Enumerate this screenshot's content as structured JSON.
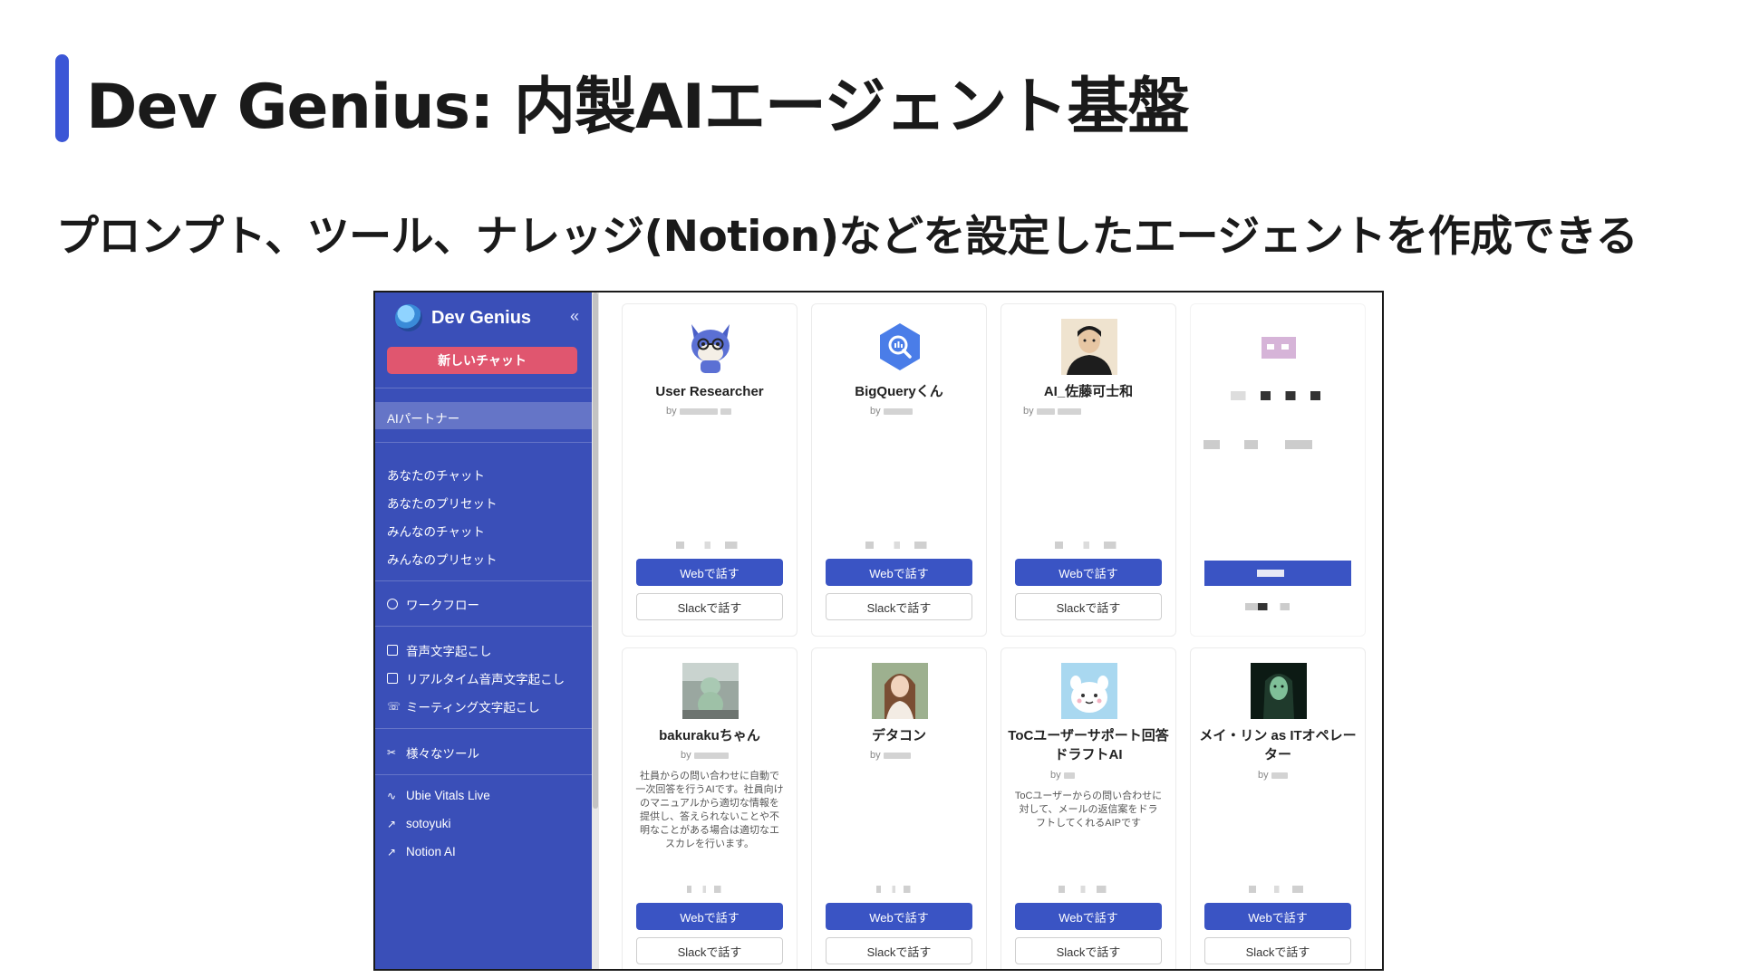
{
  "slide": {
    "title": "Dev Genius: 内製AIエージェント基盤",
    "subtitle": "プロンプト、ツール、ナレッジ(Notion)などを設定したエージェントを作成できる"
  },
  "sidebar": {
    "app_title": "Dev Genius",
    "collapse_icon": "«",
    "new_chat_label": "新しいチャット",
    "active_item": "AIパートナー",
    "items": [
      {
        "label": "あなたのチャット"
      },
      {
        "label": "あなたのプリセット"
      },
      {
        "label": "みんなのチャット"
      },
      {
        "label": "みんなのプリセット"
      },
      {
        "label": "ワークフロー",
        "icon": "workflow-icon"
      },
      {
        "label": "音声文字起こし",
        "icon": "document-icon"
      },
      {
        "label": "リアルタイム音声文字起こし",
        "icon": "screen-icon"
      },
      {
        "label": "ミーティング文字起こし",
        "icon": "phone-icon"
      },
      {
        "label": "様々なツール",
        "icon": "tools-icon"
      },
      {
        "label": "Ubie Vitals Live",
        "icon": "pulse-icon"
      },
      {
        "label": "sotoyuki",
        "icon": "external-link-icon"
      },
      {
        "label": "Notion AI",
        "icon": "external-link-icon"
      }
    ]
  },
  "agents": [
    {
      "name": "User Researcher",
      "by": "by",
      "description": "",
      "web_label": "Webで話す",
      "slack_label": "Slackで話す",
      "avatar": "cat-mascot"
    },
    {
      "name": "BigQueryくん",
      "by": "by",
      "description": "",
      "web_label": "Webで話す",
      "slack_label": "Slackで話す",
      "avatar": "bigquery-hexagon"
    },
    {
      "name": "AI_佐藤可士和",
      "by": "by",
      "description": "",
      "web_label": "Webで話す",
      "slack_label": "Slackで話す",
      "avatar": "person-portrait"
    },
    {
      "name": "",
      "by": "",
      "description": "",
      "web_label": "",
      "slack_label": "",
      "avatar": "pixelated"
    },
    {
      "name": "bakurakuちゃん",
      "by": "by",
      "description": "社員からの問い合わせに自動で一次回答を行うAIです。社員向けのマニュアルから適切な情報を提供し、答えられないことや不明なことがある場合は適切なエスカレを行います。",
      "web_label": "Webで話す",
      "slack_label": "Slackで話す",
      "avatar": "robot-photo"
    },
    {
      "name": "デタコン",
      "by": "by",
      "description": "",
      "web_label": "Webで話す",
      "slack_label": "Slackで話す",
      "avatar": "woman-portrait"
    },
    {
      "name": "ToCユーザーサポート回答ドラフトAI",
      "by": "by",
      "description": "ToCユーザーからの問い合わせに対して、メールの返信案をドラフトしてくれるAIPです",
      "web_label": "Webで話す",
      "slack_label": "Slackで話す",
      "avatar": "white-mascot"
    },
    {
      "name": "メイ・リン as ITオペレーター",
      "by": "by",
      "description": "",
      "web_label": "Webで話す",
      "slack_label": "Slackで話す",
      "avatar": "green-portrait"
    }
  ],
  "colors": {
    "accent": "#3b56d6",
    "sidebar": "#3a4fb8",
    "new_chat": "#e0566f",
    "button": "#3a54c4"
  }
}
